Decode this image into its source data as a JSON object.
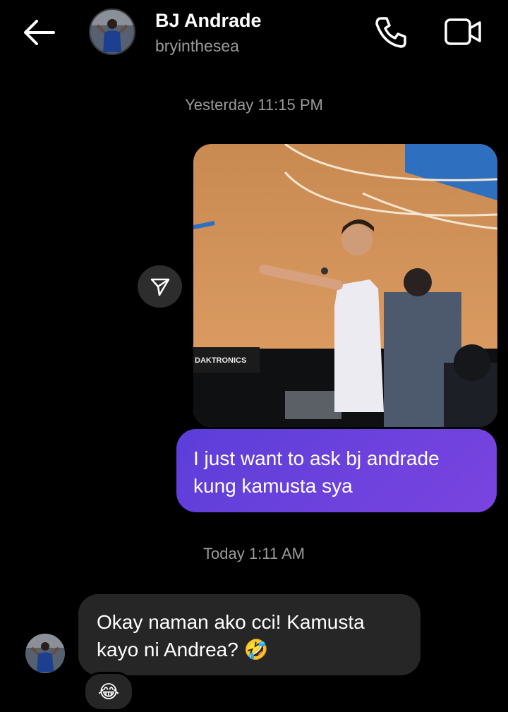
{
  "header": {
    "name": "BJ Andrade",
    "username": "bryinthesea",
    "back_icon": "arrow-left-icon",
    "call_icon": "phone-icon",
    "video_icon": "video-camera-icon"
  },
  "thread": {
    "timestamp_1": "Yesterday 11:15 PM",
    "sent_photo": {
      "scoreboard_text": "DAKTRONICS"
    },
    "share_icon": "paper-plane-icon",
    "sent_message_line1": "I just want to ask bj andrade",
    "sent_message_line2": "kung kamusta sya",
    "timestamp_2": "Today 1:11 AM",
    "received_message_line1": "Okay naman ako cci! Kamusta",
    "received_message_line2": "kayo ni Andrea? 🤣",
    "reaction": "😂"
  },
  "colors": {
    "background": "#000000",
    "sent_bubble": "#6a40dd",
    "received_bubble": "#262626",
    "meta_text": "#9a9a9a"
  }
}
